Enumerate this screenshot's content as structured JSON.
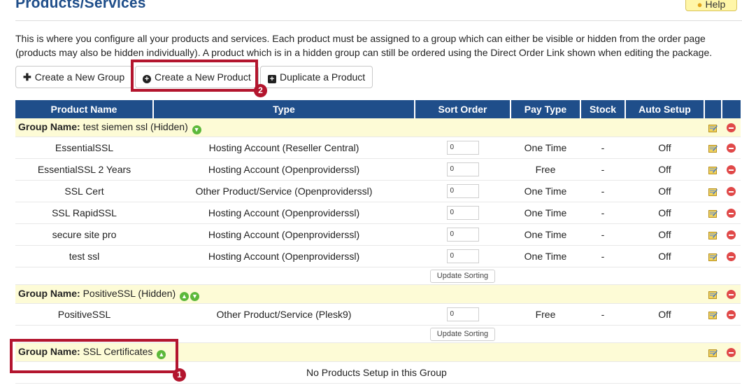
{
  "page": {
    "title": "Products/Services",
    "help_label": "Help",
    "intro": "This is where you configure all your products and services. Each product must be assigned to a group which can either be visible or hidden from the order page (products may also be hidden individually). A product which is in a hidden group can still be ordered using the Direct Order Link shown when editing the package."
  },
  "toolbar": {
    "create_group": "Create a New Group",
    "create_product": "Create a New Product",
    "duplicate_product": "Duplicate a Product"
  },
  "annotations": {
    "badge1": "1",
    "badge2": "2"
  },
  "table": {
    "headers": {
      "name": "Product Name",
      "type": "Type",
      "sort": "Sort Order",
      "pay": "Pay Type",
      "stock": "Stock",
      "auto": "Auto Setup"
    },
    "group_prefix": "Group Name:",
    "update_sorting": "Update Sorting",
    "groups": [
      {
        "name": "test siemen ssl (Hidden)",
        "products": [
          {
            "name": "EssentialSSL",
            "type": "Hosting Account (Reseller Central)",
            "sort": "0",
            "pay": "One Time",
            "stock": "-",
            "auto": "Off"
          },
          {
            "name": "EssentialSSL 2 Years",
            "type": "Hosting Account (Openproviderssl)",
            "sort": "0",
            "pay": "Free",
            "stock": "-",
            "auto": "Off"
          },
          {
            "name": "SSL Cert",
            "type": "Other Product/Service (Openproviderssl)",
            "sort": "0",
            "pay": "One Time",
            "stock": "-",
            "auto": "Off"
          },
          {
            "name": "SSL RapidSSL",
            "type": "Hosting Account (Openproviderssl)",
            "sort": "0",
            "pay": "One Time",
            "stock": "-",
            "auto": "Off"
          },
          {
            "name": "secure site pro",
            "type": "Hosting Account (Openproviderssl)",
            "sort": "0",
            "pay": "One Time",
            "stock": "-",
            "auto": "Off"
          },
          {
            "name": "test ssl",
            "type": "Hosting Account (Openproviderssl)",
            "sort": "0",
            "pay": "One Time",
            "stock": "-",
            "auto": "Off"
          }
        ]
      },
      {
        "name": "PositiveSSL (Hidden)",
        "products": [
          {
            "name": "PositiveSSL",
            "type": "Other Product/Service (Plesk9)",
            "sort": "0",
            "pay": "Free",
            "stock": "-",
            "auto": "Off"
          }
        ]
      },
      {
        "name": "SSL Certificates",
        "empty_message": "No Products Setup in this Group"
      }
    ]
  },
  "icons": {
    "up_arrow": "arrow-up-icon",
    "down_arrow": "arrow-down-icon",
    "edit": "edit-icon",
    "delete": "delete-icon",
    "bulb": "lightbulb-icon"
  },
  "colors": {
    "title": "#1f4e8a",
    "header_bg": "#1f4e8a",
    "group_bg": "#fdfbd6",
    "highlight": "#b3152e",
    "arrow_green": "#5cb83a",
    "delete_red": "#e04848"
  }
}
